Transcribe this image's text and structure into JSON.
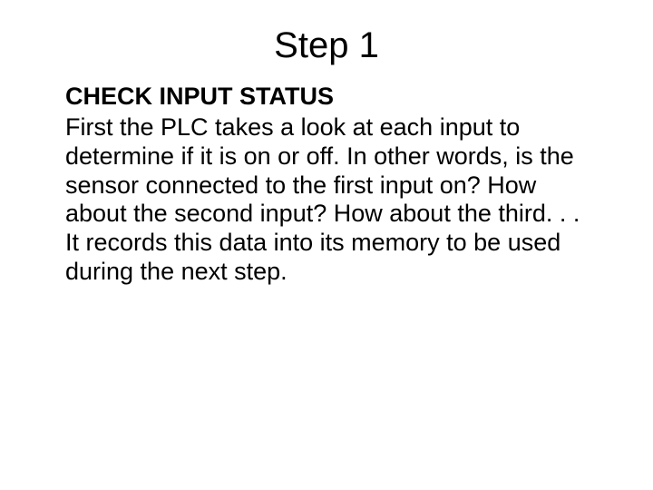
{
  "slide": {
    "title": "Step 1",
    "subhead": "CHECK INPUT STATUS",
    "body": "First the PLC takes a look at each input to determine if it is on or off. In other words, is the sensor connected to the first input on? How about the second input? How about the third. . . It records this data into its memory to be used during the next step."
  }
}
